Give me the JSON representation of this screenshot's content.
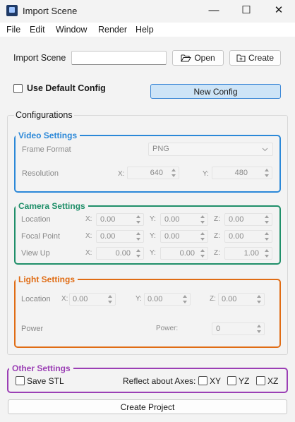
{
  "window": {
    "title": "Import Scene",
    "minimize_glyph": "—",
    "maximize_glyph": "☐",
    "close_glyph": "✕"
  },
  "menu": [
    "File",
    "Edit",
    "Window",
    "Render",
    "Help"
  ],
  "import": {
    "label": "Import Scene",
    "path_value": "",
    "open_label": "Open",
    "create_label": "Create"
  },
  "default_config": {
    "label": "Use Default Config",
    "checked": false
  },
  "new_config_label": "New Config",
  "configurations_label": "Configurations",
  "video": {
    "title": "Video Settings",
    "color": "#2b88d8",
    "frame_format_label": "Frame Format",
    "frame_format_value": "PNG",
    "resolution_label": "Resolution",
    "x_label": "X:",
    "x_value": "640",
    "y_label": "Y:",
    "y_value": "480"
  },
  "camera": {
    "title": "Camera Settings",
    "color": "#1f8f69",
    "rows": [
      {
        "label": "Location",
        "x": "0.00",
        "y": "0.00",
        "z": "0.00"
      },
      {
        "label": "Focal Point",
        "x": "0.00",
        "y": "0.00",
        "z": "0.00"
      },
      {
        "label": "View Up",
        "x": "0.00",
        "y": "0.00",
        "z": "1.00"
      }
    ],
    "x_label": "X:",
    "y_label": "Y:",
    "z_label": "Z:"
  },
  "light": {
    "title": "Light Settings",
    "color": "#e06c14",
    "location_label": "Location",
    "x_label": "X:",
    "x_value": "0.00",
    "y_label": "Y:",
    "y_value": "0.00",
    "z_label": "Z:",
    "z_value": "0.00",
    "power_label": "Power",
    "power_field_label": "Power:",
    "power_value": "0"
  },
  "other": {
    "title": "Other Settings",
    "color": "#9b3fb5",
    "save_stl_label": "Save STL",
    "reflect_label": "Reflect about Axes:",
    "axes": [
      "XY",
      "YZ",
      "XZ"
    ]
  },
  "create_project_label": "Create Project"
}
